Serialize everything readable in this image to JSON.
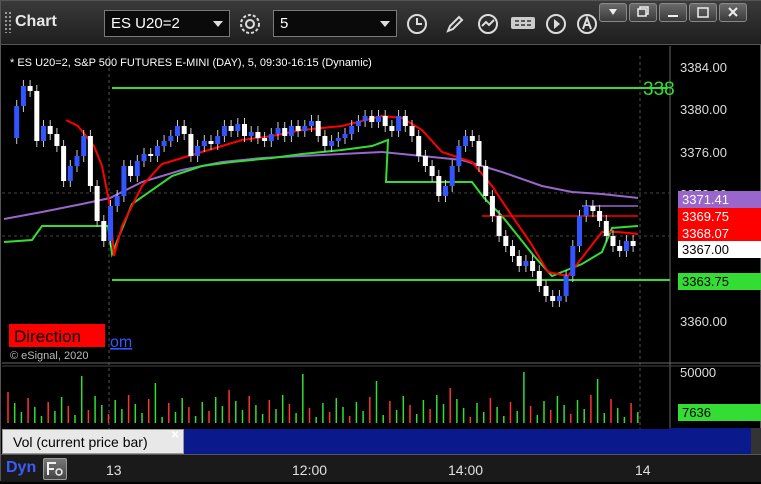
{
  "toolbar": {
    "app_title": "Chart",
    "symbol_value": "ES U20=2",
    "interval_value": "5"
  },
  "chart": {
    "header": "* ES U20=2, S&P 500 FUTURES E-MINI (DAY), 5, 09:30-16:15 (Dynamic)",
    "direction_label": "Direction",
    "watermark": "© eSignal, 2020",
    "watermark_suffix": "om",
    "right_edge_label": "338",
    "price_ticks": [
      "3384.00",
      "3380.00",
      "3376.00",
      "3372.00",
      "3360.00"
    ],
    "price_tags": [
      {
        "text": "3371.41",
        "bg": "#9966cc",
        "fg": "#ffffff"
      },
      {
        "text": "3369.75",
        "bg": "#ff0000",
        "fg": "#ffffff"
      },
      {
        "text": "3368.07",
        "bg": "#ff0000",
        "fg": "#ffffff"
      },
      {
        "text": "3367.00",
        "bg": "#ffffff",
        "fg": "#000000"
      },
      {
        "text": "3363.75",
        "bg": "#33dd33",
        "fg": "#000000"
      }
    ],
    "volume_ticks": [
      "50000"
    ],
    "volume_tag": "7636",
    "volume_panel_label": "Vol (current price bar)",
    "volume_close_glyph": "×",
    "time_labels": [
      "13",
      "12:00",
      "14:00",
      "14"
    ],
    "colors": {
      "up": "#3355ff",
      "down": "#ffffff",
      "ema_red": "#ff0000",
      "ema_green": "#33dd33",
      "ma_purple": "#9966cc",
      "level": "#33dd33"
    }
  },
  "bottom": {
    "dyn_label": "Dyn"
  }
}
